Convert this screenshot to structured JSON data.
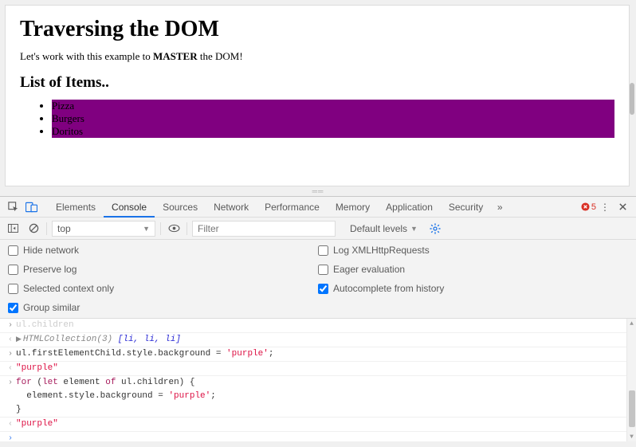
{
  "page": {
    "h1": "Traversing the DOM",
    "intro_pre": "Let's work with this example to ",
    "intro_bold": "MASTER",
    "intro_post": " the DOM!",
    "h2": "List of Items..",
    "items": [
      "Pizza",
      "Burgers",
      "Doritos"
    ]
  },
  "devtools": {
    "tabs": {
      "elements": "Elements",
      "console": "Console",
      "sources": "Sources",
      "network": "Network",
      "performance": "Performance",
      "memory": "Memory",
      "application": "Application",
      "security": "Security"
    },
    "errors": {
      "count": "5"
    },
    "toolbar": {
      "context": "top",
      "filter_placeholder": "Filter",
      "levels": "Default levels"
    },
    "settings": {
      "hide_network": "Hide network",
      "preserve_log": "Preserve log",
      "selected_context": "Selected context only",
      "group_similar": "Group similar",
      "log_xhr": "Log XMLHttpRequests",
      "eager_eval": "Eager evaluation",
      "autocomplete": "Autocomplete from history"
    },
    "console": {
      "line0_grey": "ul.children",
      "line1_grey": "HTMLCollection(3)",
      "line1_blue": " [li, li, li]",
      "line2": "ul.firstElementChild.style.background = ",
      "line2_str": "'purple'",
      "line2_semi": ";",
      "line3_str": "\"purple\"",
      "line4_for": "for",
      "line4_a": " (",
      "line4_let": "let",
      "line4_b": " element ",
      "line4_of": "of",
      "line4_c": " ul.children) {",
      "line5_a": "  element.style.background = ",
      "line5_str": "'purple'",
      "line5_b": ";",
      "line6": "}",
      "line7_str": "\"purple\""
    }
  }
}
